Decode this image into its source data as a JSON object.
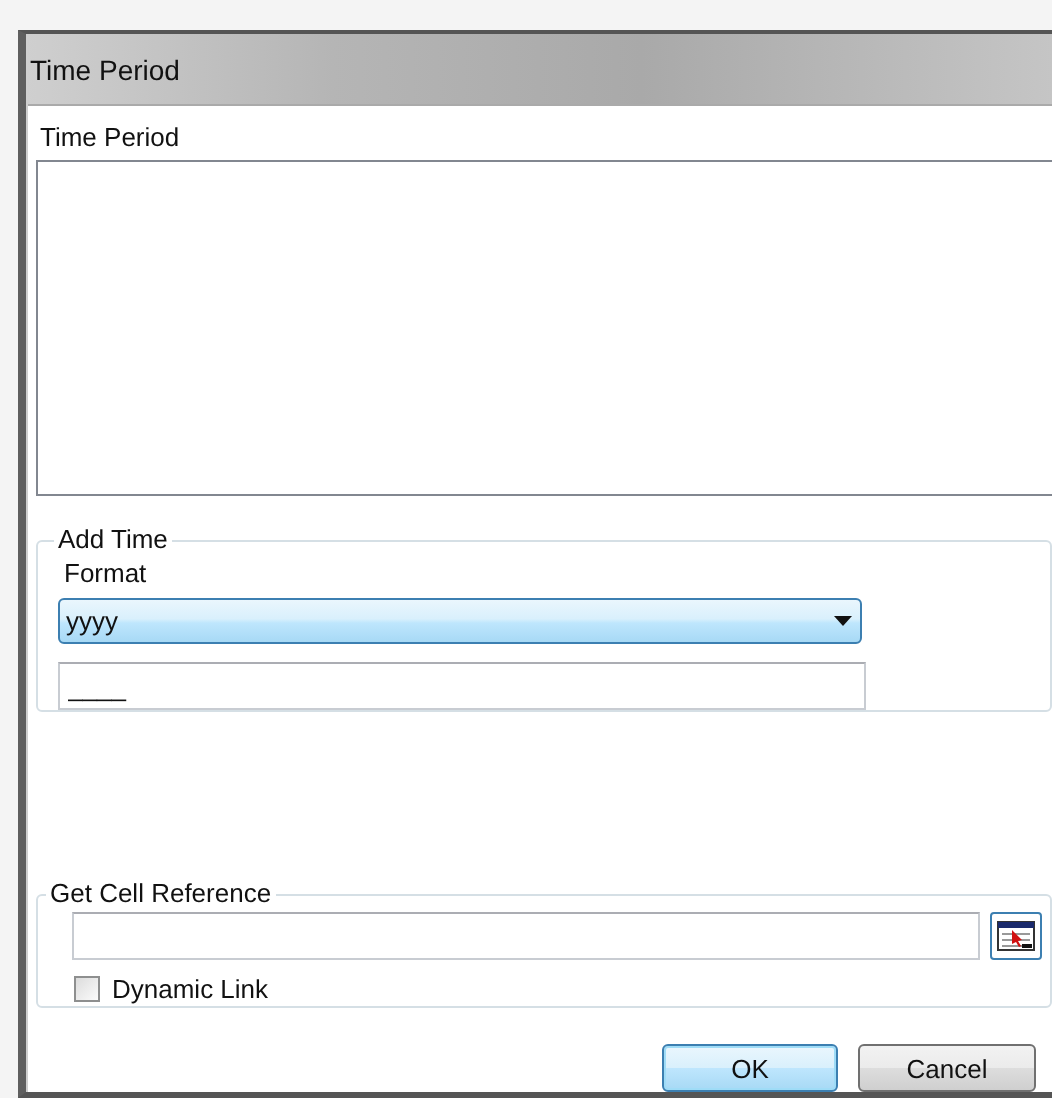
{
  "window": {
    "title": "Time Period"
  },
  "time_period": {
    "label": "Time Period"
  },
  "add_time": {
    "title": "Add Time",
    "format_label": "Format",
    "format": {
      "value": "yyyy"
    },
    "preview": {
      "value": "____"
    }
  },
  "cell_reference": {
    "title": "Get Cell Reference",
    "dynamic_link": {
      "label": "Dynamic Link",
      "checked": false
    }
  },
  "buttons": [
    {
      "label": "OK",
      "default": true
    },
    {
      "label": "Cancel",
      "default": false
    }
  ]
}
